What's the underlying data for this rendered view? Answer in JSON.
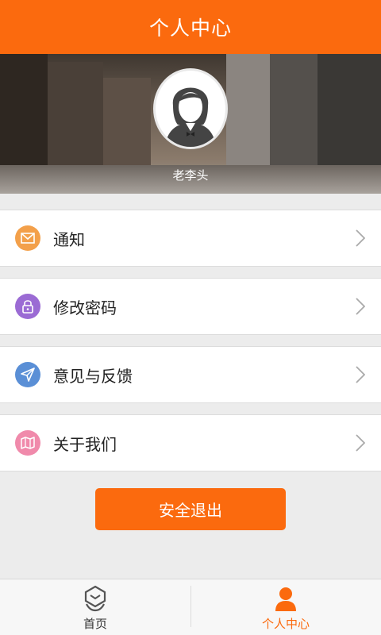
{
  "header": {
    "title": "个人中心"
  },
  "profile": {
    "username": "老李头",
    "avatar_icon": "user-avatar-female-icon"
  },
  "menu": [
    {
      "label": "通知",
      "icon": "envelope-icon",
      "color": "#f3a04a"
    },
    {
      "label": "修改密码",
      "icon": "lock-icon",
      "color": "#9b6bd4"
    },
    {
      "label": "意见与反馈",
      "icon": "paper-plane-icon",
      "color": "#5a8fd6"
    },
    {
      "label": "关于我们",
      "icon": "map-icon",
      "color": "#f08aab"
    }
  ],
  "logout_label": "安全退出",
  "tabs": [
    {
      "label": "首页",
      "icon": "home-handshake-icon",
      "active": false
    },
    {
      "label": "个人中心",
      "icon": "person-icon",
      "active": true
    }
  ],
  "colors": {
    "accent": "#fb6a0e",
    "active_tab": "#fb6a0e",
    "inactive_tab": "#333333"
  }
}
